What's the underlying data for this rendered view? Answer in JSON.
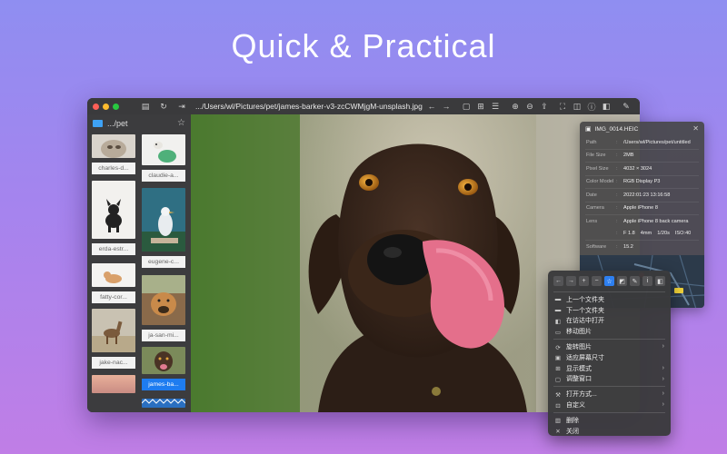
{
  "headline": "Quick & Practical",
  "window": {
    "path": ".../Users/wl/Pictures/pet/james-barker-v3-zcCWMjgM-unsplash.jpg",
    "sidebar": {
      "folder": ".../pet",
      "left_column": [
        "charles-d...",
        "erda-estr...",
        "fatty-cor...",
        "jake-nac..."
      ],
      "right_column": [
        "claudie-a...",
        "eugene-c...",
        "ja-san-mi...",
        "james-ba..."
      ],
      "selected": "james-ba..."
    }
  },
  "info_panel": {
    "title": "IMG_0014.HEIC",
    "rows": [
      {
        "k": "Path",
        "v": "/Users/wl/Pictures/pet/untitled"
      },
      {
        "k": "File Size",
        "v": "2MB"
      },
      {
        "k": "Pixel Size",
        "v": "4032 × 3024"
      },
      {
        "k": "Color Model",
        "v": "RGB Display P3"
      },
      {
        "k": "Date",
        "v": "2022:01:23 13:16:58"
      },
      {
        "k": "Camera",
        "v": "Apple iPhone 8"
      },
      {
        "k": "Lens",
        "v": "Apple iPhone 8 back camera"
      }
    ],
    "exposure": [
      "F 1.8",
      "4mm",
      "1/20s",
      "ISO:40"
    ],
    "software_label": "Software",
    "software_value": "15.2"
  },
  "context_menu": {
    "items": [
      {
        "icon": "folder-icon",
        "label": "上一个文件夹",
        "arrow": false
      },
      {
        "icon": "folder-icon",
        "label": "下一个文件夹",
        "arrow": false
      },
      {
        "icon": "finder-icon",
        "label": "在访达中打开",
        "arrow": false
      },
      {
        "icon": "move-icon",
        "label": "移动图片",
        "arrow": false
      },
      {
        "sep": true
      },
      {
        "icon": "rotate-icon",
        "label": "旋转图片",
        "arrow": true
      },
      {
        "icon": "fit-screen-icon",
        "label": "适应屏幕尺寸",
        "arrow": false
      },
      {
        "icon": "display-mode-icon",
        "label": "显示模式",
        "arrow": true
      },
      {
        "icon": "window-icon",
        "label": "调整窗口",
        "arrow": true
      },
      {
        "sep": true
      },
      {
        "icon": "open-with-icon",
        "label": "打开方式...",
        "arrow": true
      },
      {
        "icon": "custom-icon",
        "label": "自定义",
        "arrow": true
      },
      {
        "sep": true
      },
      {
        "icon": "trash-icon",
        "label": "删除",
        "arrow": false
      },
      {
        "icon": "close-icon",
        "label": "关闭",
        "arrow": false
      }
    ]
  },
  "colors": {
    "accent": "#2d7ff0",
    "folder": "#3ea2f5",
    "close_light": "#fe5f57",
    "min_light": "#febc2e",
    "max_light": "#28c840"
  }
}
